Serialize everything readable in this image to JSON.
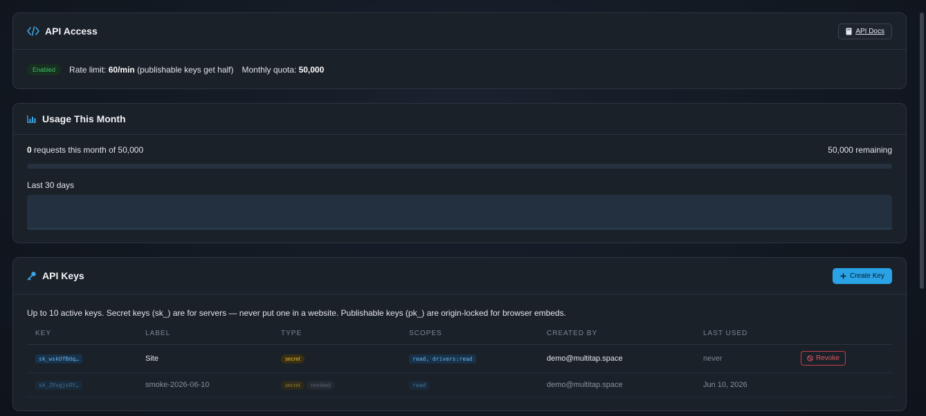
{
  "api_access": {
    "title": "API Access",
    "docs_label": "API Docs",
    "status": "Enabled",
    "rate_label": "Rate limit:",
    "rate_value": "60/min",
    "rate_note": "(publishable keys get half)",
    "quota_label": "Monthly quota:",
    "quota_value": "50,000"
  },
  "usage": {
    "title": "Usage This Month",
    "requests_count": "0",
    "requests_text": "requests this month of 50,000",
    "remaining": "50,000 remaining",
    "progress_fraction": 0,
    "history_label": "Last 30 days"
  },
  "keys": {
    "title": "API Keys",
    "create_label": "Create Key",
    "description": "Up to 10 active keys. Secret keys (sk_) are for servers — never put one in a website. Publishable keys (pk_) are origin-locked for browser embeds.",
    "columns": [
      "KEY",
      "LABEL",
      "TYPE",
      "SCOPES",
      "CREATED BY",
      "LAST USED",
      ""
    ],
    "rows": [
      {
        "key": "sk_wskUfBdq…",
        "label": "Site",
        "type": "secret",
        "status": "",
        "scopes": "read, drivers:read",
        "created_by": "demo@multitap.space",
        "last_used": "never",
        "action": "Revoke"
      },
      {
        "key": "sk_JXvgjsOY…",
        "label": "smoke-2026-06-10",
        "type": "secret",
        "status": "revoked",
        "scopes": "read",
        "created_by": "demo@multitap.space",
        "last_used": "Jun 10, 2026",
        "action": ""
      }
    ]
  },
  "colors": {
    "accent": "#2aa3e6",
    "success": "#3fbf6a",
    "danger": "#e0565f",
    "warning": "#e0b93a"
  },
  "icons": {
    "api_access": "code-icon",
    "docs": "book-icon",
    "usage": "bar-chart-icon",
    "keys": "key-icon",
    "create": "plus-icon",
    "revoke": "ban-icon"
  }
}
